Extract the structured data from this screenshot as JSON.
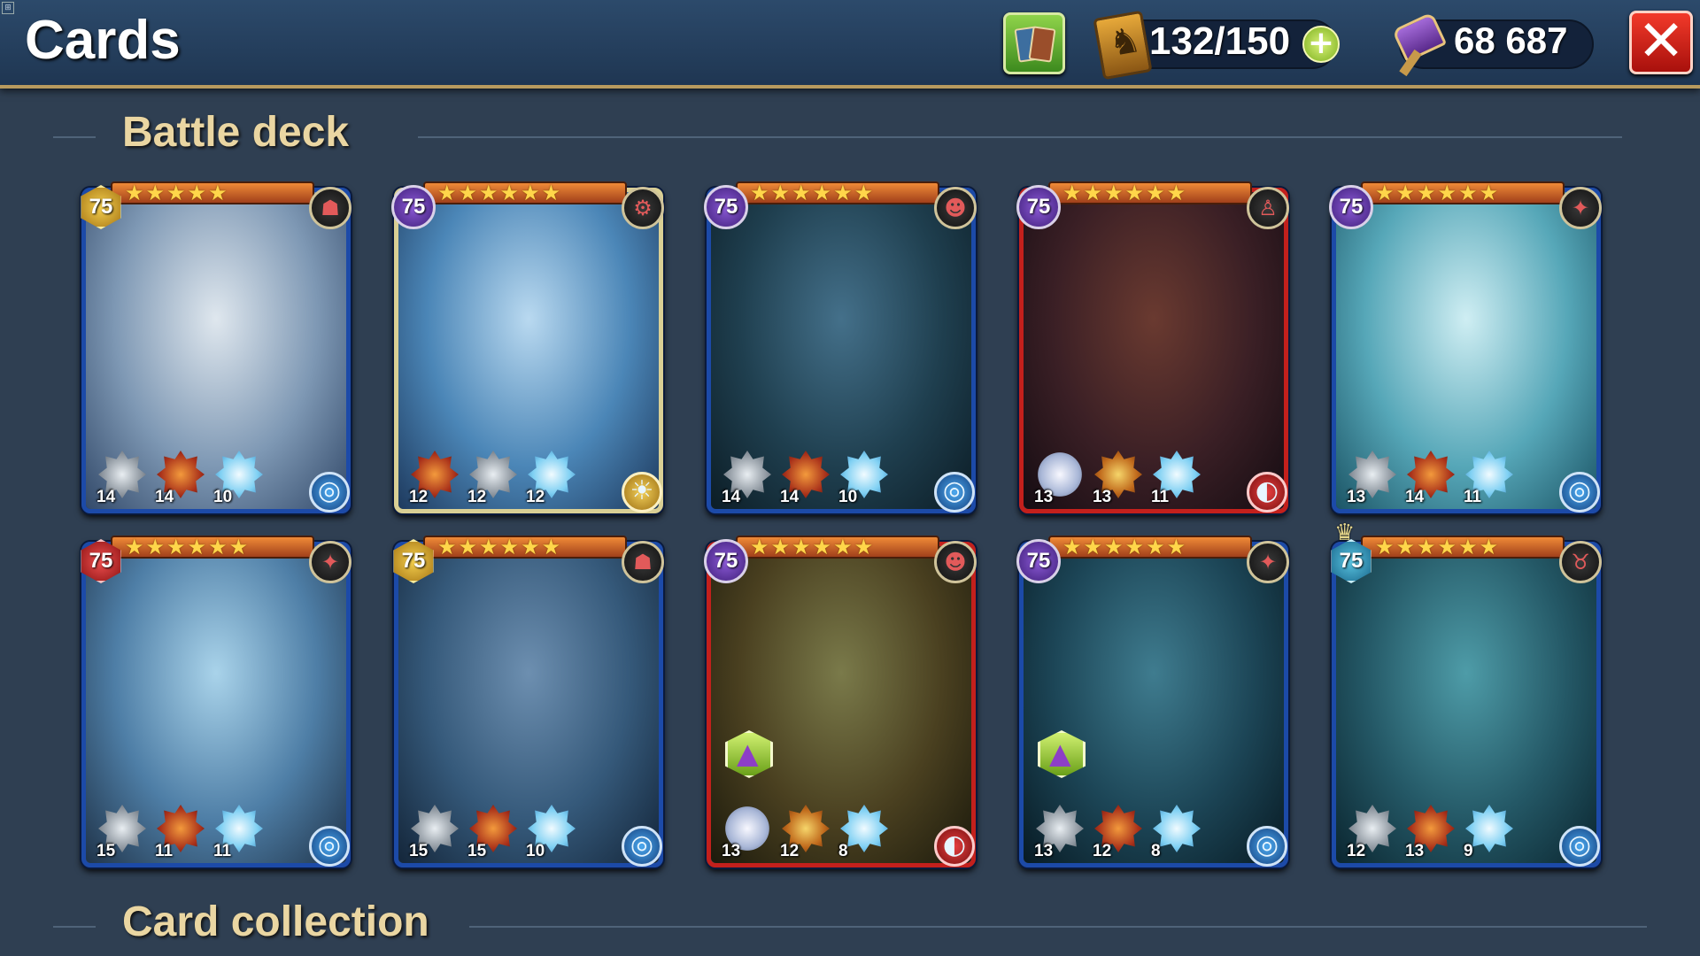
{
  "header": {
    "title": "Cards",
    "card_count": "132/150",
    "gold": "68 687",
    "icons": {
      "deck": "deck-cards-icon",
      "counter": "card-counter-icon",
      "plus": "plus-icon",
      "gold": "war-hammer-icon",
      "close": "close-icon"
    }
  },
  "sections": {
    "battle_deck": "Battle deck",
    "collection": "Card collection"
  },
  "cards": [
    {
      "level": "75",
      "stars": "★★★★★",
      "level_style": "gold",
      "frame": "blue",
      "race": "demon",
      "element": "water",
      "upgrade": false,
      "crown": false,
      "art": [
        "#dfe7ee",
        "#7e98b4",
        "#334a6a"
      ],
      "stats": [
        {
          "type": "armor",
          "value": "14"
        },
        {
          "type": "fire",
          "value": "14"
        },
        {
          "type": "ice",
          "value": "10"
        }
      ]
    },
    {
      "level": "75",
      "stars": "★★★★★★",
      "level_style": "purple",
      "frame": "gold",
      "race": "mechanism",
      "element": "light",
      "upgrade": false,
      "crown": false,
      "art": [
        "#b9d9f0",
        "#4b86b7",
        "#1e3a5e"
      ],
      "stats": [
        {
          "type": "fire",
          "value": "12"
        },
        {
          "type": "armor",
          "value": "12"
        },
        {
          "type": "ice",
          "value": "12"
        }
      ]
    },
    {
      "level": "75",
      "stars": "★★★★★★",
      "level_style": "purple",
      "frame": "blue",
      "race": "alien",
      "element": "water",
      "upgrade": false,
      "crown": false,
      "art": [
        "#44708a",
        "#1f3f4f",
        "#0c1d26"
      ],
      "stats": [
        {
          "type": "armor",
          "value": "14"
        },
        {
          "type": "fire",
          "value": "14"
        },
        {
          "type": "ice",
          "value": "10"
        }
      ]
    },
    {
      "level": "75",
      "stars": "★★★★★★",
      "level_style": "purple",
      "frame": "red",
      "race": "human",
      "element": "fire",
      "upgrade": false,
      "crown": false,
      "art": [
        "#6a3a30",
        "#3a1f25",
        "#150c12"
      ],
      "stats": [
        {
          "type": "orb",
          "value": "13"
        },
        {
          "type": "bolt",
          "value": "13"
        },
        {
          "type": "ice",
          "value": "11"
        }
      ]
    },
    {
      "level": "75",
      "stars": "★★★★★★",
      "level_style": "purple",
      "frame": "blue",
      "race": "angel",
      "element": "water",
      "upgrade": false,
      "crown": false,
      "art": [
        "#cfeef3",
        "#56a7b8",
        "#1c5566"
      ],
      "stats": [
        {
          "type": "armor",
          "value": "13"
        },
        {
          "type": "fire",
          "value": "14"
        },
        {
          "type": "ice",
          "value": "11"
        }
      ]
    },
    {
      "level": "75",
      "stars": "★★★★★★",
      "level_style": "red",
      "frame": "blue",
      "race": "angel",
      "element": "water",
      "upgrade": false,
      "crown": false,
      "art": [
        "#a9d3ea",
        "#4e7ea6",
        "#20344a"
      ],
      "stats": [
        {
          "type": "armor",
          "value": "15"
        },
        {
          "type": "fire",
          "value": "11"
        },
        {
          "type": "ice",
          "value": "11"
        }
      ]
    },
    {
      "level": "75",
      "stars": "★★★★★★",
      "level_style": "gold",
      "frame": "blue",
      "race": "demon",
      "element": "water",
      "upgrade": false,
      "crown": false,
      "art": [
        "#6d8fb0",
        "#35597a",
        "#14263a"
      ],
      "stats": [
        {
          "type": "armor",
          "value": "15"
        },
        {
          "type": "fire",
          "value": "15"
        },
        {
          "type": "ice",
          "value": "10"
        }
      ]
    },
    {
      "level": "75",
      "stars": "★★★★★★",
      "level_style": "purple",
      "frame": "red",
      "race": "alien",
      "element": "fire",
      "upgrade": true,
      "crown": false,
      "art": [
        "#7a7a4a",
        "#4a4020",
        "#1c1a0c"
      ],
      "stats": [
        {
          "type": "orb",
          "value": "13"
        },
        {
          "type": "bolt",
          "value": "12"
        },
        {
          "type": "ice",
          "value": "8"
        }
      ]
    },
    {
      "level": "75",
      "stars": "★★★★★★",
      "level_style": "purple",
      "frame": "blue",
      "race": "angel",
      "element": "water",
      "upgrade": true,
      "crown": false,
      "art": [
        "#3f7c8f",
        "#1c4556",
        "#081b24"
      ],
      "stats": [
        {
          "type": "armor",
          "value": "13"
        },
        {
          "type": "fire",
          "value": "12"
        },
        {
          "type": "ice",
          "value": "8"
        }
      ]
    },
    {
      "level": "75",
      "stars": "★★★★★★",
      "level_style": "teal",
      "frame": "blue",
      "race": "beast",
      "element": "water",
      "upgrade": false,
      "crown": true,
      "art": [
        "#4e9ca8",
        "#245866",
        "#0b2630"
      ],
      "stats": [
        {
          "type": "armor",
          "value": "12"
        },
        {
          "type": "fire",
          "value": "13"
        },
        {
          "type": "ice",
          "value": "9"
        }
      ]
    }
  ],
  "colors": {
    "background": "#2f3f52",
    "section_title": "#ead6a2",
    "blue_frame": "#1c4aa8",
    "red_frame": "#c3201c",
    "gold_frame": "#d9cf94"
  }
}
